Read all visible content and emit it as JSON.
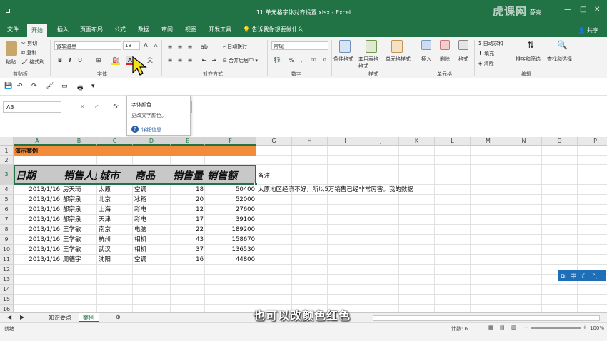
{
  "window": {
    "title": "11.单元格字体对齐设置.xlsx - Excel",
    "user": "薛亮",
    "watermark": "虎课网"
  },
  "tabs": [
    "文件",
    "开始",
    "插入",
    "页面布局",
    "公式",
    "数据",
    "审阅",
    "视图",
    "开发工具"
  ],
  "active_tab": "开始",
  "tell_me": "告诉我你想要做什么",
  "share": "共享",
  "ribbon": {
    "clipboard": {
      "paste": "粘贴",
      "cut": "剪切",
      "copy": "复制",
      "painter": "格式刷",
      "label": "剪贴板"
    },
    "font": {
      "name": "微软雅黑",
      "size": "18",
      "label": "字体",
      "bold": "B",
      "italic": "I",
      "underline": "U"
    },
    "alignment": {
      "wrap": "自动换行",
      "merge": "合并后居中",
      "label": "对齐方式"
    },
    "number": {
      "format": "常规",
      "label": "数字"
    },
    "styles": {
      "cond": "条件格式",
      "table": "套用表格格式",
      "cell": "单元格样式",
      "label": "样式"
    },
    "cells": {
      "insert": "插入",
      "delete": "删除",
      "format": "格式",
      "label": "单元格"
    },
    "editing": {
      "autosum": "自动求和",
      "fill": "填充",
      "clear": "清除",
      "sort": "排序和筛选",
      "find": "查找和选择",
      "label": "编辑"
    }
  },
  "colors": {
    "excel_green": "#217346",
    "title_fill": "#f28c3a",
    "header_fill": "#c8c8c8",
    "font_red": "#e02020",
    "font_yellow": "#f4e11a"
  },
  "namebox": "A3",
  "tooltip": {
    "title": "字体颜色",
    "desc": "更改文字颜色。",
    "more": "详细信息"
  },
  "grid": {
    "columns": [
      "A",
      "B",
      "C",
      "D",
      "E",
      "F",
      "G",
      "H",
      "I",
      "J",
      "K",
      "L",
      "M",
      "N",
      "O",
      "P"
    ],
    "rows": [
      "1",
      "2",
      "3",
      "4",
      "5",
      "6",
      "7",
      "8",
      "9",
      "10",
      "11",
      "12",
      "13",
      "14",
      "15",
      "16"
    ],
    "title": "演示案例",
    "headers": [
      "日期",
      "销售人员",
      "城市",
      "商品",
      "销售量",
      "销售额"
    ],
    "note_label": "备注",
    "note": "太原地区经济不好，所以5万销售已经非常厉害。我的数据",
    "data": [
      [
        "2013/1/16",
        "房天琦",
        "太原",
        "空调",
        "18",
        "50400"
      ],
      [
        "2013/1/16",
        "郝宗泉",
        "北京",
        "冰箱",
        "20",
        "52000"
      ],
      [
        "2013/1/16",
        "郝宗泉",
        "上海",
        "彩电",
        "12",
        "27600"
      ],
      [
        "2013/1/16",
        "郝宗泉",
        "天津",
        "彩电",
        "17",
        "39100"
      ],
      [
        "2013/1/16",
        "王学敏",
        "南京",
        "电脑",
        "22",
        "189200"
      ],
      [
        "2013/1/16",
        "王学敏",
        "杭州",
        "相机",
        "43",
        "158670"
      ],
      [
        "2013/1/16",
        "王学敏",
        "武汉",
        "相机",
        "37",
        "136530"
      ],
      [
        "2013/1/16",
        "周德宇",
        "沈阳",
        "空调",
        "16",
        "44800"
      ]
    ]
  },
  "sheets": [
    "知识要点",
    "案例"
  ],
  "active_sheet": "案例",
  "status": {
    "ready": "就绪",
    "count": "计数: 6",
    "zoom": "100%"
  },
  "subtitle": "也可以改颜色红色",
  "ime": "中"
}
